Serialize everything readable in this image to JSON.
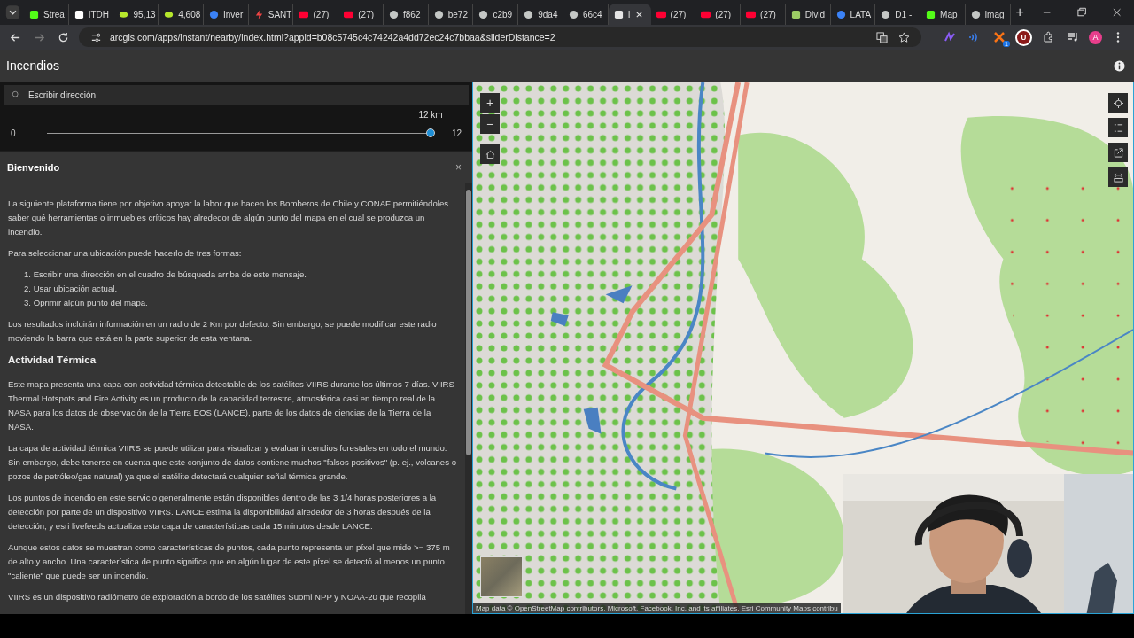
{
  "browser": {
    "tabs": [
      {
        "label": "Strea",
        "kind": "square",
        "selected": false
      },
      {
        "label": "ITDH",
        "kind": "square",
        "selected": false
      },
      {
        "label": "95,13",
        "kind": "leaf",
        "selected": false
      },
      {
        "label": "4,608",
        "kind": "leaf",
        "selected": false
      },
      {
        "label": "Inver",
        "kind": "dot",
        "selected": false
      },
      {
        "label": "SANT",
        "kind": "bolt",
        "selected": false
      },
      {
        "label": "(27)",
        "kind": "video",
        "selected": false
      },
      {
        "label": "(27)",
        "kind": "video",
        "selected": false
      },
      {
        "label": "f862",
        "kind": "globe",
        "selected": false
      },
      {
        "label": "be72",
        "kind": "globe",
        "selected": false
      },
      {
        "label": "c2b9",
        "kind": "globe",
        "selected": false
      },
      {
        "label": "9da4",
        "kind": "globe",
        "selected": false
      },
      {
        "label": "66c4",
        "kind": "globe",
        "selected": false
      },
      {
        "label": "I",
        "kind": "square",
        "selected": true
      },
      {
        "label": "(27)",
        "kind": "video",
        "selected": false
      },
      {
        "label": "(27)",
        "kind": "video",
        "selected": false
      },
      {
        "label": "(27)",
        "kind": "video",
        "selected": false
      },
      {
        "label": "Divid",
        "kind": "square",
        "selected": false
      },
      {
        "label": "LATA",
        "kind": "dot",
        "selected": false
      },
      {
        "label": "D1 -",
        "kind": "globe",
        "selected": false
      },
      {
        "label": "Map",
        "kind": "square",
        "selected": false
      },
      {
        "label": "imag",
        "kind": "globe",
        "selected": false
      }
    ],
    "new_tab": "+",
    "url": "arcgis.com/apps/instant/nearby/index.html?appid=b08c5745c4c74242a4dd72ec24c7bbaa&sliderDistance=2",
    "extension_letter": "U",
    "extension_badge": "1",
    "profile": "A"
  },
  "app": {
    "title": "Incendios",
    "search": {
      "placeholder": "Escribir dirección"
    },
    "distance": {
      "min": "0",
      "max": "12",
      "reading": "12 km",
      "level": 1
    },
    "panel": {
      "title": "Bienvenido",
      "close": "×",
      "content": [
        {
          "kind": "p",
          "text": "La siguiente plataforma tiene por objetivo apoyar la labor que hacen los Bomberos de Chile y CONAF permitiéndoles saber qué herramientas o inmuebles críticos hay alrededor de algún punto del mapa en el cual se produzca un incendio."
        },
        {
          "kind": "p",
          "text": "Para seleccionar una ubicación puede hacerlo de tres formas:"
        },
        {
          "kind": "list",
          "items": [
            "1. Escribir una dirección en el cuadro de búsqueda arriba de este mensaje.",
            "2. Usar ubicación actual.",
            "3. Oprimir algún punto del mapa."
          ]
        },
        {
          "kind": "p",
          "text": "Los resultados incluirán información en un radio de 2 Km por defecto. Sin embargo, se puede modificar este radio moviendo la barra que está en la parte superior de esta ventana."
        },
        {
          "kind": "heading",
          "text": "Actividad Térmica"
        },
        {
          "kind": "p",
          "text": "Este mapa presenta una capa con actividad térmica detectable de los satélites VIIRS durante los últimos 7 días. VIIRS Thermal Hotspots and Fire Activity es un producto de la capacidad terrestre, atmosférica casi en tiempo real de la NASA para los datos de observación de la Tierra EOS (LANCE), parte de los datos de ciencias de la Tierra de la NASA."
        },
        {
          "kind": "p",
          "text": "La capa de actividad térmica VIIRS se puede utilizar para visualizar y evaluar incendios forestales en todo el mundo. Sin embargo, debe tenerse en cuenta que este conjunto de datos contiene muchos \"falsos positivos\" (p. ej., volcanes o pozos de petróleo/gas natural) ya que el satélite detectará cualquier señal térmica grande."
        },
        {
          "kind": "p",
          "text": "Los puntos de incendio en este servicio generalmente están disponibles dentro de las 3 1/4 horas posteriores a la detección por parte de un dispositivo VIIRS. LANCE estima la disponibilidad alrededor de 3 horas después de la detección, y esri livefeeds actualiza esta capa de características cada 15 minutos desde LANCE."
        },
        {
          "kind": "p",
          "text": "Aunque estos datos se muestran como características de puntos, cada punto representa un píxel que mide >= 375 m de alto y ancho. Una característica de punto significa que en algún lugar de este píxel se detectó al menos un punto \"caliente\" que puede ser un incendio."
        },
        {
          "kind": "p",
          "text": "VIIRS es un dispositivo radiómetro de exploración a bordo de los satélites Suomi NPP y NOAA-20 que recopila"
        }
      ]
    },
    "map": {
      "zoom_in": "+",
      "zoom_out": "−",
      "attribution": "Map data © OpenStreetMap contributors, Microsoft, Facebook, Inc. and its affiliates, Esri Community Maps contribu"
    }
  }
}
